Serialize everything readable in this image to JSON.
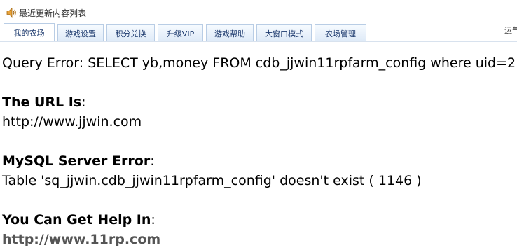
{
  "news": {
    "icon": "speaker-icon",
    "label": "最近更新内容列表"
  },
  "right_text": "运气",
  "tabs": [
    {
      "label": "我的农场"
    },
    {
      "label": "游戏设置"
    },
    {
      "label": "积分兑换"
    },
    {
      "label": "升级VIP"
    },
    {
      "label": "游戏帮助"
    },
    {
      "label": "大窗口模式"
    },
    {
      "label": "农场管理"
    }
  ],
  "error": {
    "query": "Query Error: SELECT yb,money FROM cdb_jjwin11rpfarm_config where uid=2",
    "url_heading": "The URL Is",
    "url_value": "http://www.jjwin.com",
    "server_heading": "MySQL Server Error",
    "server_value": "Table 'sq_jjwin.cdb_jjwin11rpfarm_config' doesn't exist ( 1146 )",
    "help_heading": "You Can Get Help In",
    "help_link": "http://www.11rp.com"
  }
}
